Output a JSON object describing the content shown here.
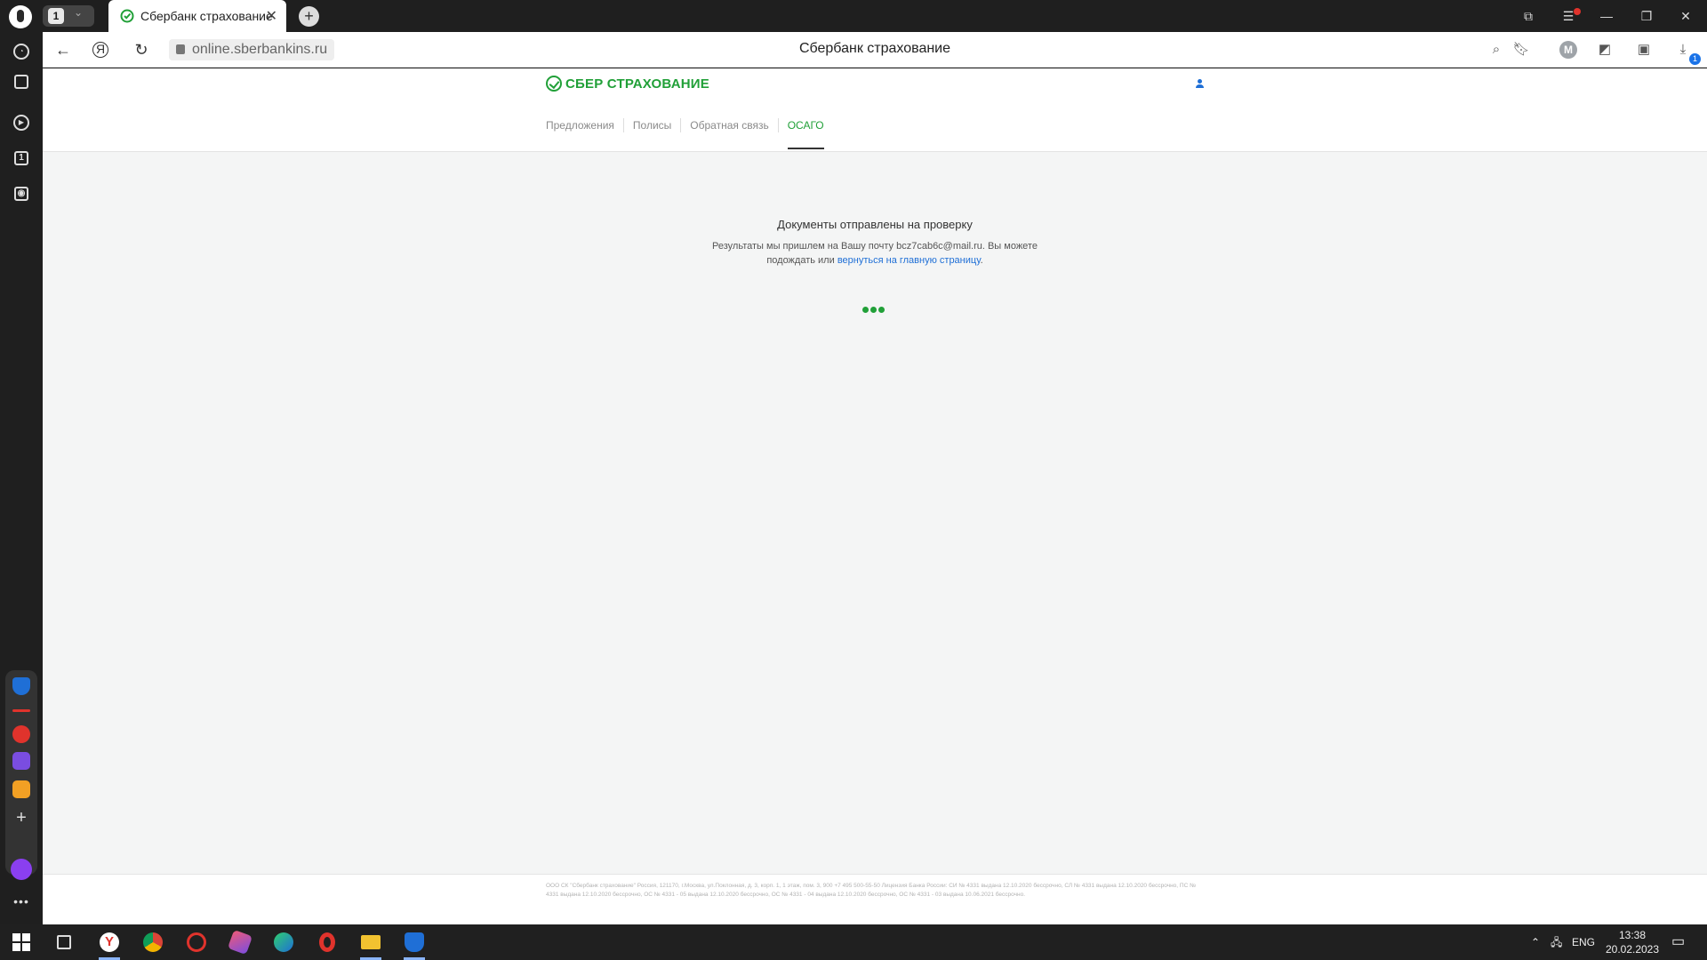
{
  "browser": {
    "tab_count": "1",
    "tab_title": "Сбербанк страхование",
    "url": "online.sberbankins.ru",
    "page_title": "Сбербанк страхование",
    "profile_letter": "M",
    "download_count": "1"
  },
  "site": {
    "logo_text": "СБЕР СТРАХОВАНИЕ",
    "nav": [
      "Предложения",
      "Полисы",
      "Обратная связь",
      "ОСАГО"
    ],
    "active_nav": "ОСАГО",
    "message_title": "Документы отправлены на проверку",
    "message_line1": "Результаты мы пришлем на Вашу почту bcz7cab6c@mail.ru. Вы можете",
    "message_line2_prefix": "подождать или",
    "message_link": "вернуться на главную страницу",
    "message_line2_suffix": ".",
    "footer": "ООО СК \"Сбербанк страхование\" Россия, 121170, г.Москва, ул.Поклонная, д. 3, корп. 1, 1 этаж, пом. 3, 900 +7 495 500-55-50 Лицензия Банка России: СИ № 4331 выдана 12.10.2020 бессрочно, СЛ № 4331 выдана 12.10.2020 бессрочно, ПС № 4331 выдана 12.10.2020 бессрочно, ОС № 4331 - 05 выдана 12.10.2020 бессрочно, ОС № 4331 - 04 выдана 12.10.2020 бессрочно, ОС № 4331 - 03 выдана 10.06.2021 бессрочно."
  },
  "taskbar": {
    "language": "ENG",
    "time": "13:38",
    "date": "20.02.2023"
  },
  "colors": {
    "sber_green": "#21a038",
    "link_blue": "#1f6fd6"
  }
}
